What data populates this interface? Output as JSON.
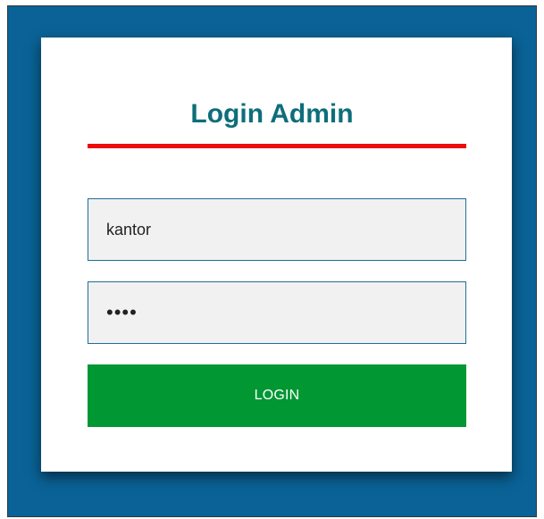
{
  "login": {
    "title": "Login Admin",
    "username_value": "kantor",
    "password_value": "pass",
    "button_label": "LOGIN"
  },
  "colors": {
    "background": "#0a6296",
    "title": "#0d6e7a",
    "title_rule": "#ee0a0a",
    "field_border": "#1f6f98",
    "field_fill": "#f1f1f1",
    "button": "#019733"
  }
}
